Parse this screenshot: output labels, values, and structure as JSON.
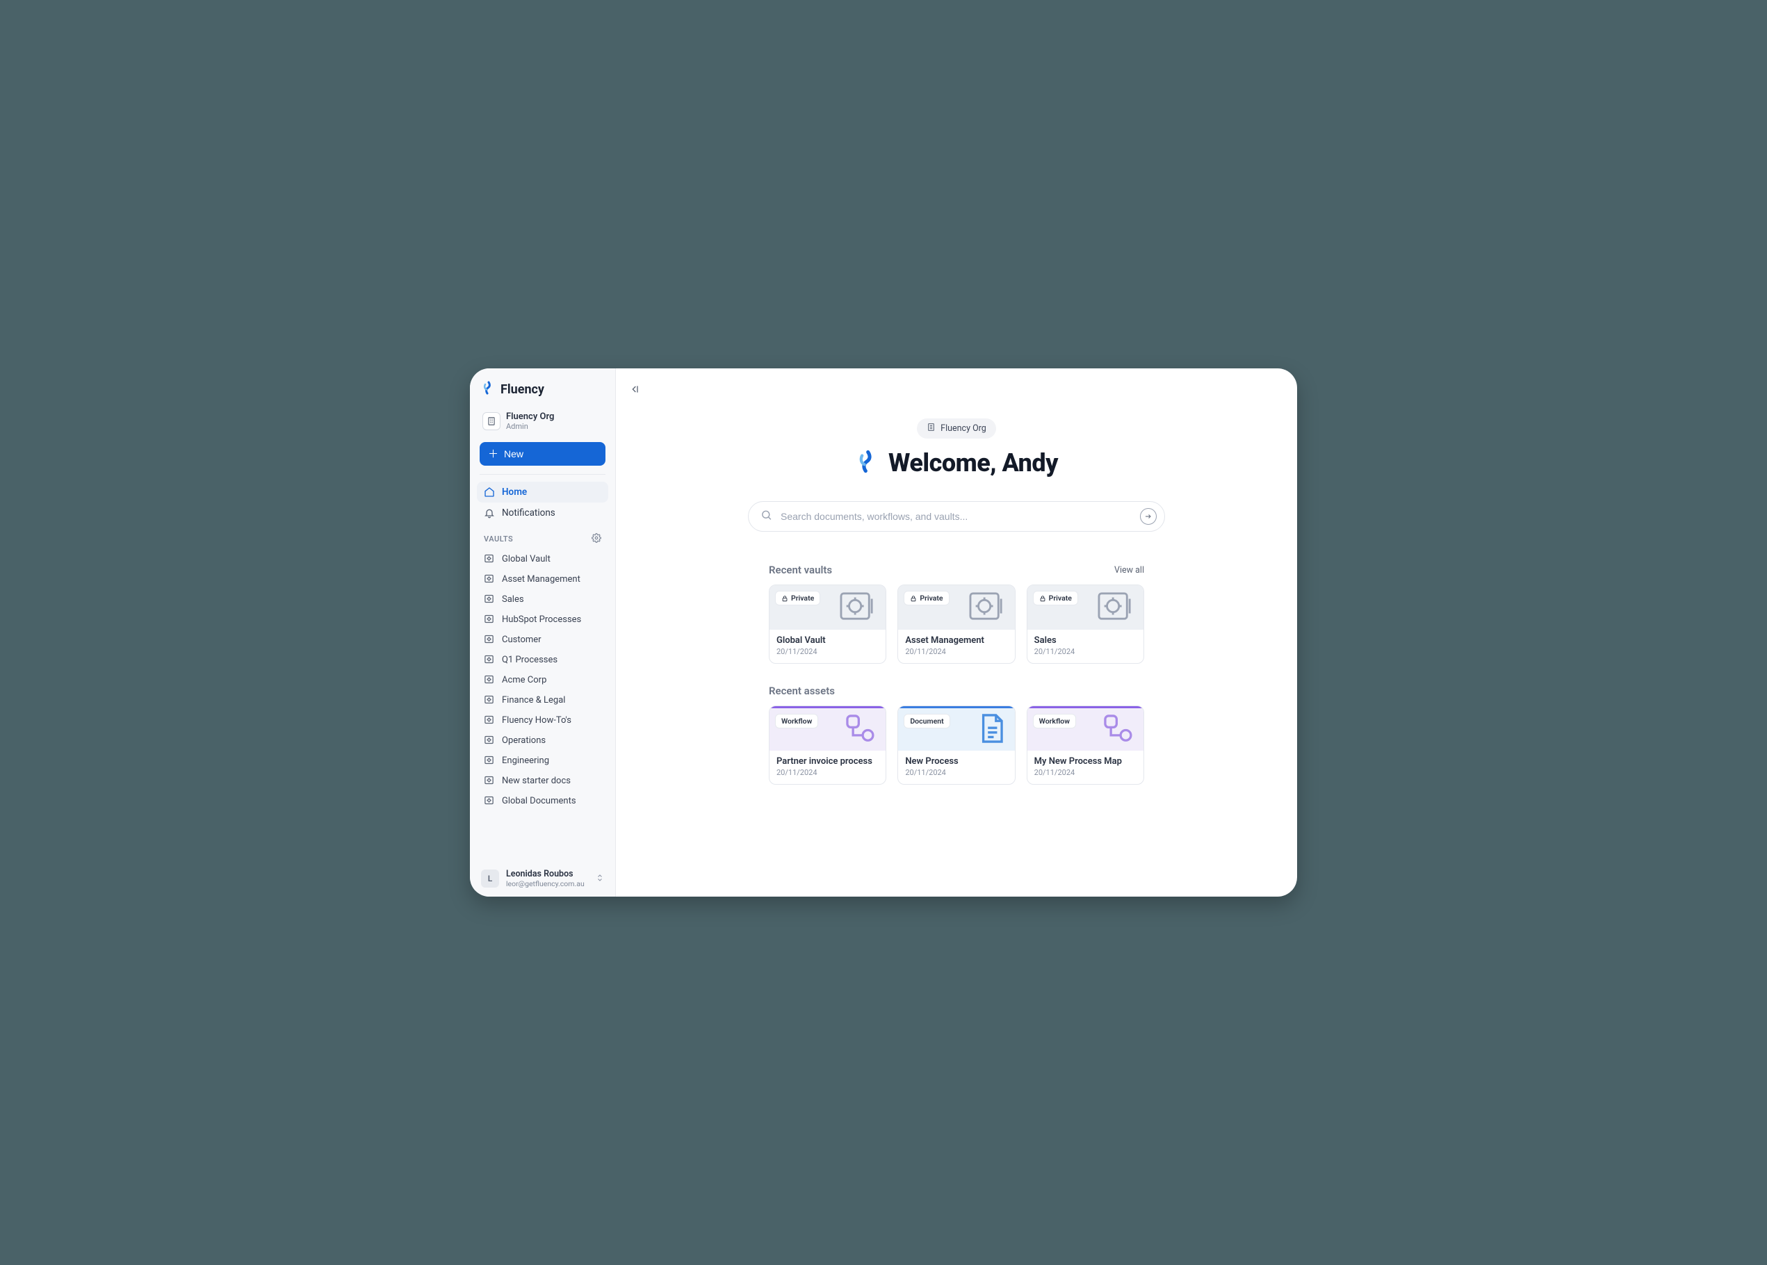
{
  "brand": {
    "name": "Fluency"
  },
  "org": {
    "name": "Fluency Org",
    "role": "Admin"
  },
  "new_button_label": "New",
  "nav": {
    "home": "Home",
    "notifications": "Notifications"
  },
  "vaults_section_label": "VAULTS",
  "vaults": [
    "Global Vault",
    "Asset Management",
    "Sales",
    "HubSpot Processes",
    "Customer",
    "Q1 Processes",
    "Acme Corp",
    "Finance & Legal",
    "Fluency How-To's",
    "Operations",
    "Engineering",
    "New starter docs",
    "Global Documents"
  ],
  "user": {
    "initial": "L",
    "name": "Leonidas Roubos",
    "email": "leor@getfluency.com.au"
  },
  "hero": {
    "org_pill": "Fluency Org",
    "welcome": "Welcome, Andy"
  },
  "search": {
    "placeholder": "Search documents, workflows, and vaults..."
  },
  "sections": {
    "recent_vaults": {
      "title": "Recent vaults",
      "view_all": "View all"
    },
    "recent_assets": {
      "title": "Recent assets"
    }
  },
  "badges": {
    "private": "Private",
    "workflow": "Workflow",
    "document": "Document"
  },
  "recent_vaults": [
    {
      "title": "Global Vault",
      "date": "20/11/2024"
    },
    {
      "title": "Asset Management",
      "date": "20/11/2024"
    },
    {
      "title": "Sales",
      "date": "20/11/2024"
    }
  ],
  "recent_assets": [
    {
      "type": "workflow",
      "title": "Partner invoice process",
      "date": "20/11/2024"
    },
    {
      "type": "document",
      "title": "New Process",
      "date": "20/11/2024"
    },
    {
      "type": "workflow",
      "title": "My New Process Map",
      "date": "20/11/2024"
    }
  ]
}
